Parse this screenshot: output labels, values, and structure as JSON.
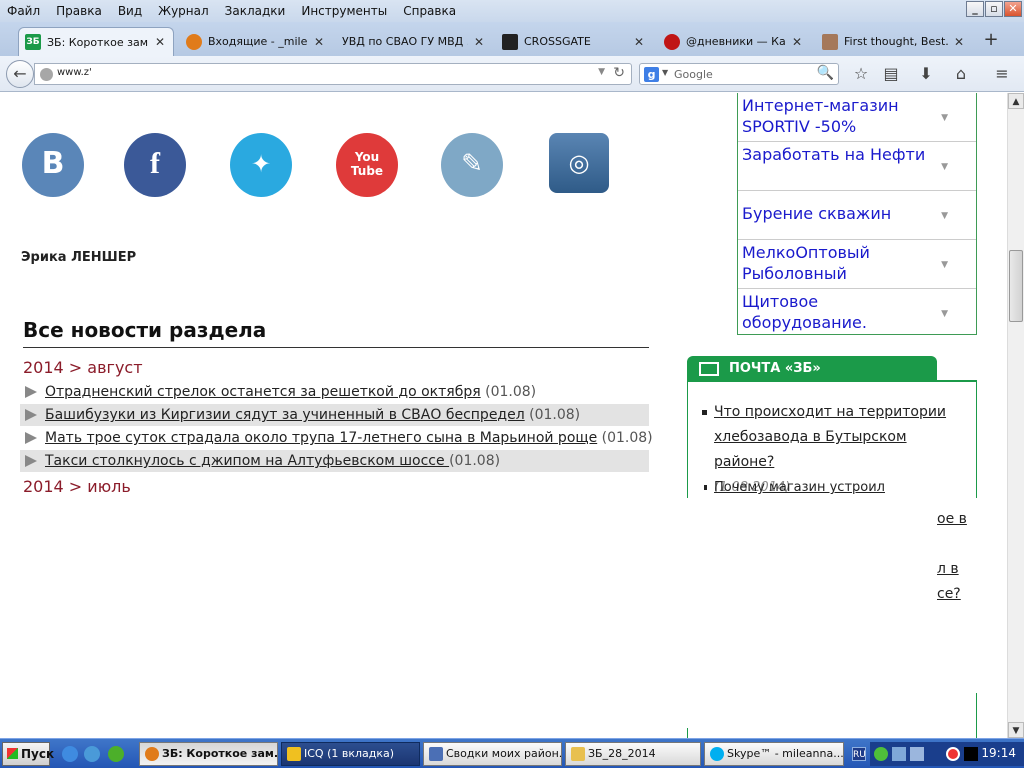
{
  "menubar": {
    "items": [
      "Файл",
      "Правка",
      "Вид",
      "Журнал",
      "Закладки",
      "Инструменты",
      "Справка"
    ]
  },
  "window_controls": {
    "minimize": "_",
    "maximize": "▫",
    "close": "✕"
  },
  "tabs": [
    {
      "label": "ЗБ: Короткое зам...",
      "icon": "zb-favicon",
      "color": "#1b9a49",
      "active": true
    },
    {
      "label": "Входящие - _milen...",
      "icon": "mail-favicon",
      "color": "#e07b1a",
      "active": false
    },
    {
      "label": "УВД по СВАО ГУ МВД ...",
      "icon": "none",
      "color": "",
      "active": false
    },
    {
      "label": "CROSSGATE",
      "icon": "crossgate-favicon",
      "color": "#222222",
      "active": false
    },
    {
      "label": "@дневники — Ка...",
      "icon": "diary-favicon",
      "color": "#c01515",
      "active": false
    },
    {
      "label": "First thought, Best...",
      "icon": "photo-favicon",
      "color": "#a5785a",
      "active": false
    }
  ],
  "navbar": {
    "url": "www.z'",
    "search_placeholder": "Google"
  },
  "page": {
    "social": [
      {
        "name": "vk",
        "glyph": "B",
        "color": "#5a86b8"
      },
      {
        "name": "facebook",
        "glyph": "f",
        "color": "#3b5998"
      },
      {
        "name": "twitter",
        "glyph": "🐦",
        "color": "#2aa9e0"
      },
      {
        "name": "youtube",
        "glyph": "You\nTube",
        "color": "#df3a3a"
      },
      {
        "name": "livejournal",
        "glyph": "✎",
        "color": "#7fa8c6"
      },
      {
        "name": "instagram",
        "glyph": "📷",
        "color": "#2f5b88"
      }
    ],
    "author": "Эрика ЛЕНШЕР",
    "section_title": "Все новости раздела",
    "date_august": "2014 > август",
    "date_july": "2014 > июль",
    "news": [
      {
        "title": "Отрадненский стрелок останется за решеткой до октября",
        "date": " (01.08)"
      },
      {
        "title": "Башибузуки из Киргизии сядут за учиненный в СВАО беспредел",
        "date": " (01.08)"
      },
      {
        "title": "Мать трое суток страдала около трупа 17-летнего сына в Марьиной роще",
        "date": " (01.08)"
      },
      {
        "title": "Такси столкнулось с джипом на Алтуфьевском шоссе ",
        "date": "(01.08)"
      }
    ],
    "ads": [
      "Интернет-магазин SPORTIV -50%",
      "Заработать на Нефти",
      "Бурение скважин",
      "МелкоОптовый Рыболовный",
      "Щитовое оборудование."
    ],
    "mail_title": "ПОЧТА «ЗБ»",
    "mail_items": [
      {
        "text": "Что происходит на территории хлебозавода в Бутырском районе?",
        "date": "(1.08.2014)"
      },
      {
        "text": "Почему магазин устроил незаконные",
        "date": ""
      }
    ],
    "fragments": [
      "ое в",
      "л в",
      "се?"
    ]
  },
  "taskbar": {
    "start": "Пуск",
    "buttons": [
      {
        "label": "ЗБ: Короткое зам...",
        "color": "#e07b1a",
        "active": true
      },
      {
        "label": "ICQ (1 вкладка)",
        "color": "#f0c020",
        "active": false
      },
      {
        "label": "Сводки моих район...",
        "color": "#4b6fb5",
        "active": false
      },
      {
        "label": "ЗБ_28_2014",
        "color": "#e8c050",
        "active": false
      },
      {
        "label": "Skype™ - mileanna...",
        "color": "#00aff0",
        "active": false
      }
    ],
    "lang": "RU",
    "clock": "19:14"
  }
}
